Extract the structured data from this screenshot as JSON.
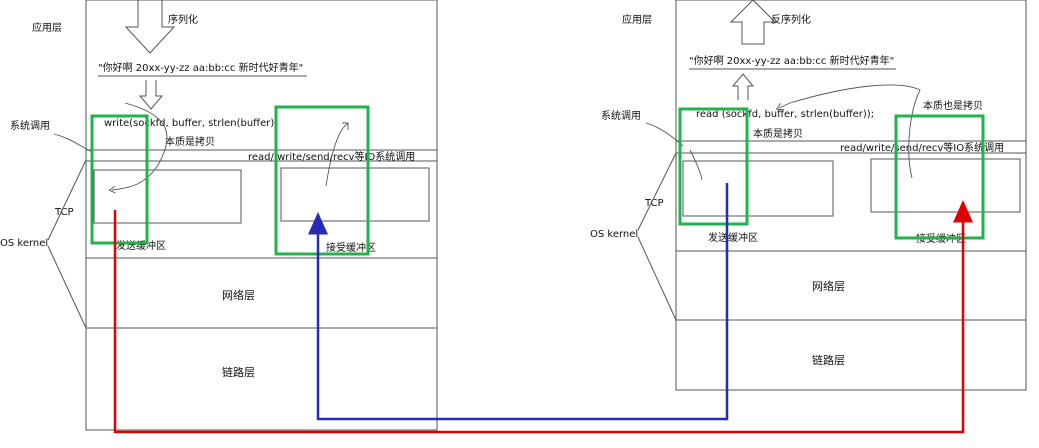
{
  "diagram": {
    "left": {
      "app_layer": "应用层",
      "arrow_label": "序列化",
      "message": "\"你好啊 20xx-yy-zz aa:bb:cc 新时代好青年\"",
      "syscall_code": "write(sockfd, buffer, strlen(buffer))",
      "copy_note": "本质是拷贝",
      "io_bar": "read/ write/send/recv等IO系统调用",
      "syscall_label": "系统调用",
      "tcp_label": "TCP",
      "os_label": "OS kernel",
      "send_buffer": "发送缓冲区",
      "recv_buffer": "接受缓冲区",
      "network_layer": "网络层",
      "link_layer": "链路层"
    },
    "right": {
      "app_layer": "应用层",
      "arrow_label": "反序列化",
      "message": "\"你好啊 20xx-yy-zz aa:bb:cc 新时代好青年\"",
      "syscall_code": "read (sockfd, buffer, strlen(buffer));",
      "copy_note": "本质是拷贝",
      "copy_note_2": "本质也是拷贝",
      "io_bar": "read/write/send/recv等IO系统调用",
      "syscall_label": "系统调用",
      "tcp_label": "TCP",
      "os_label": "OS kernel",
      "send_buffer": "发送缓冲区",
      "recv_buffer": "接受缓冲区",
      "network_layer": "网络层",
      "link_layer": "链路层"
    },
    "colors": {
      "highlight_box": "#22b14c",
      "red_path": "#e00000",
      "blue_path": "#2a2ab8",
      "outline": "#555555"
    }
  }
}
